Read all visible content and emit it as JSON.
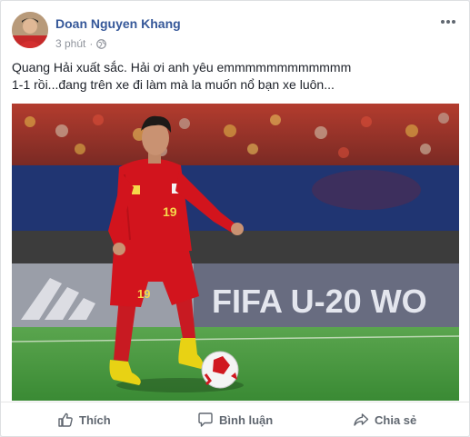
{
  "post": {
    "author": "Doan Nguyen Khang",
    "time": "3 phút",
    "separator": "·",
    "privacy_icon": "globe-icon",
    "more_icon": "more-options-icon",
    "text_lines": [
      "Quang Hải xuất sắc. Hải ơi anh yêu emmmmmmmmmmmm",
      "1-1 rồi...đang trên xe đi làm mà la muốn nổ bạn xe luôn..."
    ],
    "photo": {
      "jersey_number": "19",
      "board_text": "FIFA U-20 WO"
    }
  },
  "actions": {
    "like": "Thích",
    "comment": "Bình luận",
    "share": "Chia sẻ"
  },
  "colors": {
    "author_link": "#365899",
    "meta_text": "#90949c",
    "action_text": "#606770",
    "jersey_red": "#d2141d",
    "pitch_green": "#3f8f3a"
  }
}
